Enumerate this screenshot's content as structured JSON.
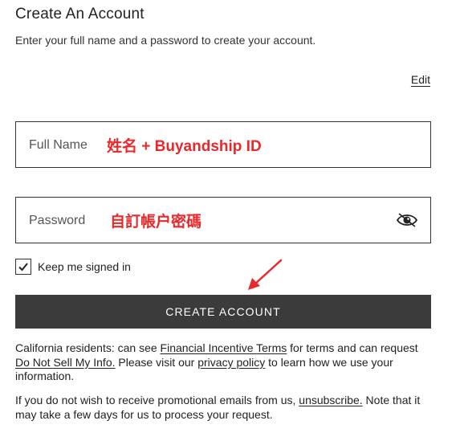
{
  "header": {
    "title": "Create An Account",
    "subtitle": "Enter your full name and a password to create your account."
  },
  "edit_label": "Edit",
  "fields": {
    "full_name": {
      "label": "Full Name",
      "annotation": "姓名 + Buyandship ID"
    },
    "password": {
      "label": "Password",
      "annotation": "自訂帳户密碼",
      "icon": "eye-icon"
    }
  },
  "remember": {
    "label": "Keep me signed in",
    "checked": true
  },
  "submit_label": "CREATE ACCOUNT",
  "colors": {
    "button_bg": "#3b3b3b",
    "annotation": "#e8282b",
    "arrow": "#e8282b"
  },
  "legal": {
    "p1_text1": "California residents: can see ",
    "p1_link1": "Financial Incentive Terms",
    "p1_text2": " for terms and can request ",
    "p1_link2": "Do Not Sell My Info.",
    "p1_text3": " Please visit our ",
    "p1_link3": "privacy policy",
    "p1_text4": " to learn how we use your information.",
    "p2_text1": "If you do not wish to receive promotional emails from us, ",
    "p2_link1": "unsubscribe.",
    "p2_text2": " Note that it may take a few days for us to process your request."
  }
}
